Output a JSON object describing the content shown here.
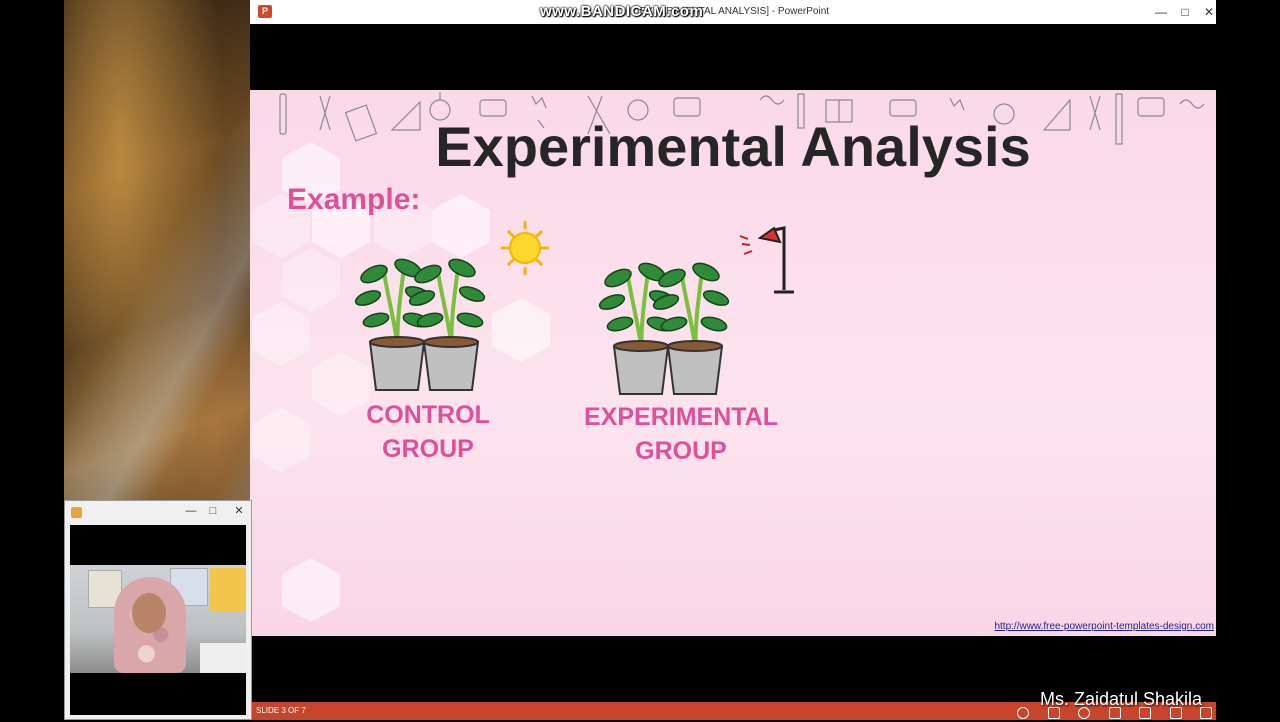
{
  "powerpoint": {
    "window_title": "[EXPERIMENTAL ANALYSIS] - PowerPoint",
    "watermark": "www.BANDICAM.com",
    "app_icon_letter": "P"
  },
  "slide": {
    "title": "Experimental Analysis",
    "subtitle": "Example:",
    "control_group": {
      "line1": "CONTROL",
      "line2": "GROUP"
    },
    "experimental_group": {
      "line1": "EXPERIMENTAL",
      "line2": "GROUP"
    },
    "url": "http://www.free-powerpoint-templates-design.com",
    "accent_color": "#e0509a",
    "title_color": "#262626"
  },
  "statusbar": {
    "slide_counter": "SLIDE 3 OF 7",
    "color": "#c8452c"
  },
  "presenter": {
    "name": "Ms. Zaidatul Shakila"
  },
  "webcam": {
    "buttons": [
      "minimize",
      "maximize",
      "close"
    ]
  },
  "icons": {
    "sun": "sun-icon",
    "lamp": "desk-lamp-icon",
    "plant": "potted-plant-icon"
  }
}
